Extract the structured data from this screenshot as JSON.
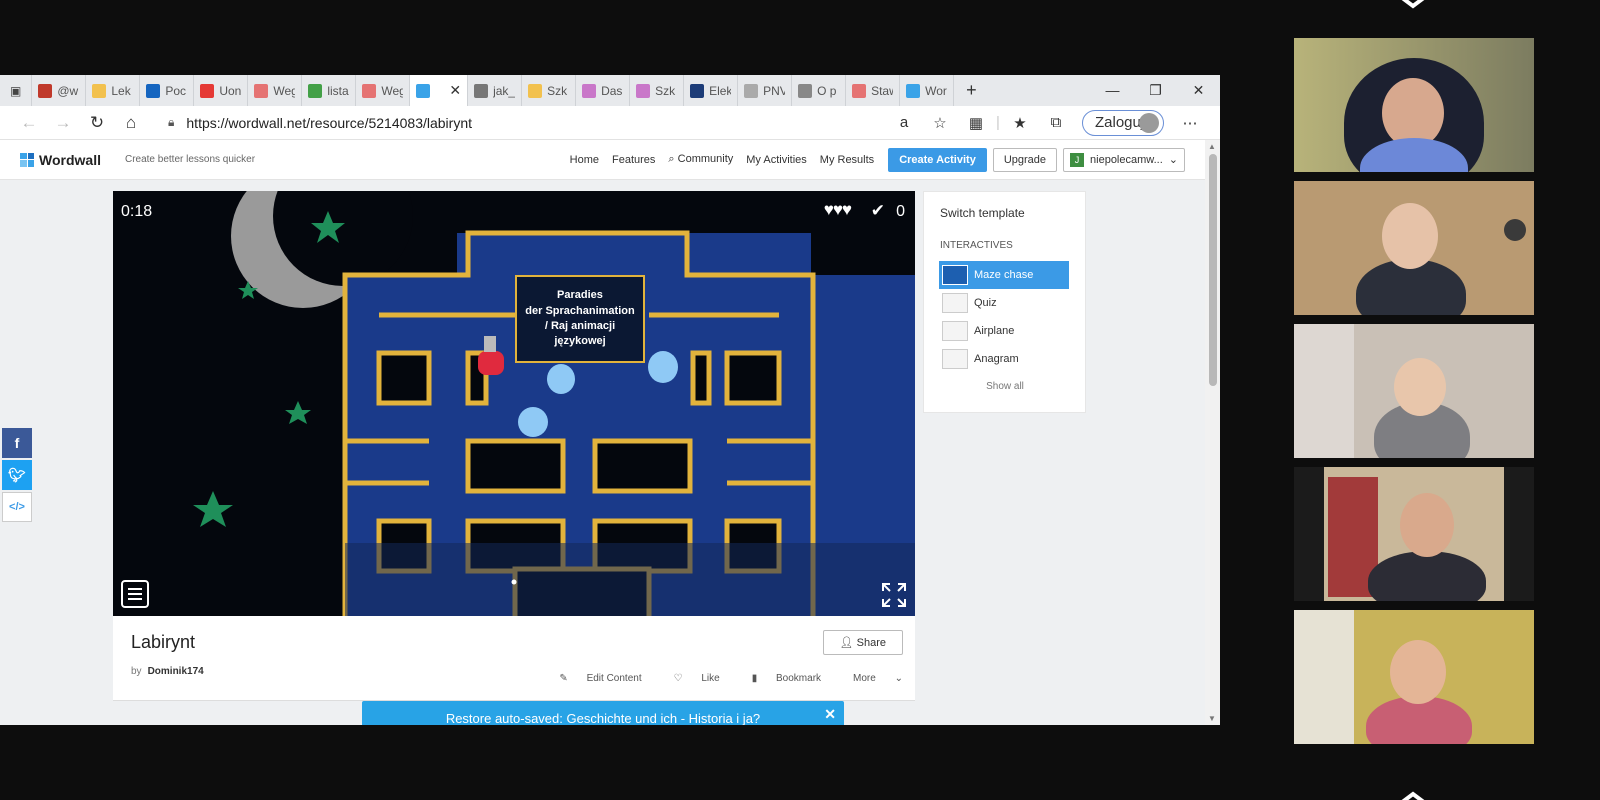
{
  "browser": {
    "tabs": [
      {
        "label": "@w",
        "color": "#c0392b"
      },
      {
        "label": "Lek",
        "color": "#f2c14e"
      },
      {
        "label": "Poc",
        "color": "#1565c0"
      },
      {
        "label": "Uon",
        "color": "#e53935"
      },
      {
        "label": "Weg",
        "color": "#e57373"
      },
      {
        "label": "lista",
        "color": "#43a047"
      },
      {
        "label": "Weg",
        "color": "#e57373"
      },
      {
        "label": "",
        "color": "#3aa3e8"
      },
      {
        "label": "jak_",
        "color": "#777777"
      },
      {
        "label": "Szk",
        "color": "#f2c14e"
      },
      {
        "label": "Das",
        "color": "#c977c9"
      },
      {
        "label": "Szk",
        "color": "#c977c9"
      },
      {
        "label": "Elek",
        "color": "#1d3c78"
      },
      {
        "label": "PNV",
        "color": "#aaaaaa"
      },
      {
        "label": "O p",
        "color": "#888888"
      },
      {
        "label": "Staw",
        "color": "#e57373"
      },
      {
        "label": "Wor",
        "color": "#3aa3e8"
      }
    ],
    "url": "https://wordwall.net/resource/5214083/labirynt",
    "login_label": "Zaloguj"
  },
  "wordwall": {
    "logo": "Wordwall",
    "tagline": "Create better lessons quicker",
    "nav": [
      "Home",
      "Features",
      "Community",
      "My Activities",
      "My Results"
    ],
    "create_label": "Create Activity",
    "upgrade_label": "Upgrade",
    "user_initial": "J",
    "user_label": "niepolecamw..."
  },
  "game": {
    "timer": "0:18",
    "hearts": "♥♥♥",
    "score": "0",
    "question_line1": "Paradies",
    "question_line2": "der Sprachanimation",
    "question_line3": "/ Raj animacji",
    "question_line4": "językowej"
  },
  "activity": {
    "title": "Labirynt",
    "by": "by",
    "author": "Dominik174",
    "share_label": "Share",
    "edit_label": "Edit Content",
    "like_label": "Like",
    "bookmark_label": "Bookmark",
    "more_label": "More"
  },
  "restore": {
    "prefix": "Restore auto-saved:",
    "name": "Geschichte und ich - Historia i ja?"
  },
  "switch_template": {
    "title": "Switch template",
    "section": "INTERACTIVES",
    "items": [
      "Maze chase",
      "Quiz",
      "Airplane",
      "Anagram"
    ],
    "show_all": "Show all"
  },
  "colors": {
    "accent": "#3b9ae6",
    "maze_wall": "#e2b33c",
    "maze_floor": "#1a3a8a",
    "facebook": "#3b5998",
    "twitter": "#1da1f2"
  }
}
